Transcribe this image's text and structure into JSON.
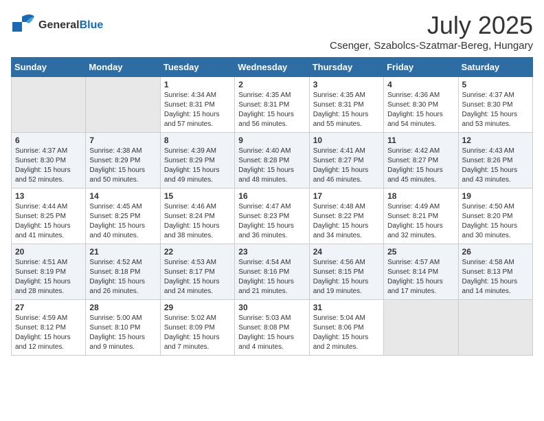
{
  "header": {
    "logo_general": "General",
    "logo_blue": "Blue",
    "month_title": "July 2025",
    "location": "Csenger, Szabolcs-Szatmar-Bereg, Hungary"
  },
  "weekdays": [
    "Sunday",
    "Monday",
    "Tuesday",
    "Wednesday",
    "Thursday",
    "Friday",
    "Saturday"
  ],
  "weeks": [
    [
      {
        "day": "",
        "sunrise": "",
        "sunset": "",
        "daylight": ""
      },
      {
        "day": "",
        "sunrise": "",
        "sunset": "",
        "daylight": ""
      },
      {
        "day": "1",
        "sunrise": "Sunrise: 4:34 AM",
        "sunset": "Sunset: 8:31 PM",
        "daylight": "Daylight: 15 hours and 57 minutes."
      },
      {
        "day": "2",
        "sunrise": "Sunrise: 4:35 AM",
        "sunset": "Sunset: 8:31 PM",
        "daylight": "Daylight: 15 hours and 56 minutes."
      },
      {
        "day": "3",
        "sunrise": "Sunrise: 4:35 AM",
        "sunset": "Sunset: 8:31 PM",
        "daylight": "Daylight: 15 hours and 55 minutes."
      },
      {
        "day": "4",
        "sunrise": "Sunrise: 4:36 AM",
        "sunset": "Sunset: 8:30 PM",
        "daylight": "Daylight: 15 hours and 54 minutes."
      },
      {
        "day": "5",
        "sunrise": "Sunrise: 4:37 AM",
        "sunset": "Sunset: 8:30 PM",
        "daylight": "Daylight: 15 hours and 53 minutes."
      }
    ],
    [
      {
        "day": "6",
        "sunrise": "Sunrise: 4:37 AM",
        "sunset": "Sunset: 8:30 PM",
        "daylight": "Daylight: 15 hours and 52 minutes."
      },
      {
        "day": "7",
        "sunrise": "Sunrise: 4:38 AM",
        "sunset": "Sunset: 8:29 PM",
        "daylight": "Daylight: 15 hours and 50 minutes."
      },
      {
        "day": "8",
        "sunrise": "Sunrise: 4:39 AM",
        "sunset": "Sunset: 8:29 PM",
        "daylight": "Daylight: 15 hours and 49 minutes."
      },
      {
        "day": "9",
        "sunrise": "Sunrise: 4:40 AM",
        "sunset": "Sunset: 8:28 PM",
        "daylight": "Daylight: 15 hours and 48 minutes."
      },
      {
        "day": "10",
        "sunrise": "Sunrise: 4:41 AM",
        "sunset": "Sunset: 8:27 PM",
        "daylight": "Daylight: 15 hours and 46 minutes."
      },
      {
        "day": "11",
        "sunrise": "Sunrise: 4:42 AM",
        "sunset": "Sunset: 8:27 PM",
        "daylight": "Daylight: 15 hours and 45 minutes."
      },
      {
        "day": "12",
        "sunrise": "Sunrise: 4:43 AM",
        "sunset": "Sunset: 8:26 PM",
        "daylight": "Daylight: 15 hours and 43 minutes."
      }
    ],
    [
      {
        "day": "13",
        "sunrise": "Sunrise: 4:44 AM",
        "sunset": "Sunset: 8:25 PM",
        "daylight": "Daylight: 15 hours and 41 minutes."
      },
      {
        "day": "14",
        "sunrise": "Sunrise: 4:45 AM",
        "sunset": "Sunset: 8:25 PM",
        "daylight": "Daylight: 15 hours and 40 minutes."
      },
      {
        "day": "15",
        "sunrise": "Sunrise: 4:46 AM",
        "sunset": "Sunset: 8:24 PM",
        "daylight": "Daylight: 15 hours and 38 minutes."
      },
      {
        "day": "16",
        "sunrise": "Sunrise: 4:47 AM",
        "sunset": "Sunset: 8:23 PM",
        "daylight": "Daylight: 15 hours and 36 minutes."
      },
      {
        "day": "17",
        "sunrise": "Sunrise: 4:48 AM",
        "sunset": "Sunset: 8:22 PM",
        "daylight": "Daylight: 15 hours and 34 minutes."
      },
      {
        "day": "18",
        "sunrise": "Sunrise: 4:49 AM",
        "sunset": "Sunset: 8:21 PM",
        "daylight": "Daylight: 15 hours and 32 minutes."
      },
      {
        "day": "19",
        "sunrise": "Sunrise: 4:50 AM",
        "sunset": "Sunset: 8:20 PM",
        "daylight": "Daylight: 15 hours and 30 minutes."
      }
    ],
    [
      {
        "day": "20",
        "sunrise": "Sunrise: 4:51 AM",
        "sunset": "Sunset: 8:19 PM",
        "daylight": "Daylight: 15 hours and 28 minutes."
      },
      {
        "day": "21",
        "sunrise": "Sunrise: 4:52 AM",
        "sunset": "Sunset: 8:18 PM",
        "daylight": "Daylight: 15 hours and 26 minutes."
      },
      {
        "day": "22",
        "sunrise": "Sunrise: 4:53 AM",
        "sunset": "Sunset: 8:17 PM",
        "daylight": "Daylight: 15 hours and 24 minutes."
      },
      {
        "day": "23",
        "sunrise": "Sunrise: 4:54 AM",
        "sunset": "Sunset: 8:16 PM",
        "daylight": "Daylight: 15 hours and 21 minutes."
      },
      {
        "day": "24",
        "sunrise": "Sunrise: 4:56 AM",
        "sunset": "Sunset: 8:15 PM",
        "daylight": "Daylight: 15 hours and 19 minutes."
      },
      {
        "day": "25",
        "sunrise": "Sunrise: 4:57 AM",
        "sunset": "Sunset: 8:14 PM",
        "daylight": "Daylight: 15 hours and 17 minutes."
      },
      {
        "day": "26",
        "sunrise": "Sunrise: 4:58 AM",
        "sunset": "Sunset: 8:13 PM",
        "daylight": "Daylight: 15 hours and 14 minutes."
      }
    ],
    [
      {
        "day": "27",
        "sunrise": "Sunrise: 4:59 AM",
        "sunset": "Sunset: 8:12 PM",
        "daylight": "Daylight: 15 hours and 12 minutes."
      },
      {
        "day": "28",
        "sunrise": "Sunrise: 5:00 AM",
        "sunset": "Sunset: 8:10 PM",
        "daylight": "Daylight: 15 hours and 9 minutes."
      },
      {
        "day": "29",
        "sunrise": "Sunrise: 5:02 AM",
        "sunset": "Sunset: 8:09 PM",
        "daylight": "Daylight: 15 hours and 7 minutes."
      },
      {
        "day": "30",
        "sunrise": "Sunrise: 5:03 AM",
        "sunset": "Sunset: 8:08 PM",
        "daylight": "Daylight: 15 hours and 4 minutes."
      },
      {
        "day": "31",
        "sunrise": "Sunrise: 5:04 AM",
        "sunset": "Sunset: 8:06 PM",
        "daylight": "Daylight: 15 hours and 2 minutes."
      },
      {
        "day": "",
        "sunrise": "",
        "sunset": "",
        "daylight": ""
      },
      {
        "day": "",
        "sunrise": "",
        "sunset": "",
        "daylight": ""
      }
    ]
  ]
}
